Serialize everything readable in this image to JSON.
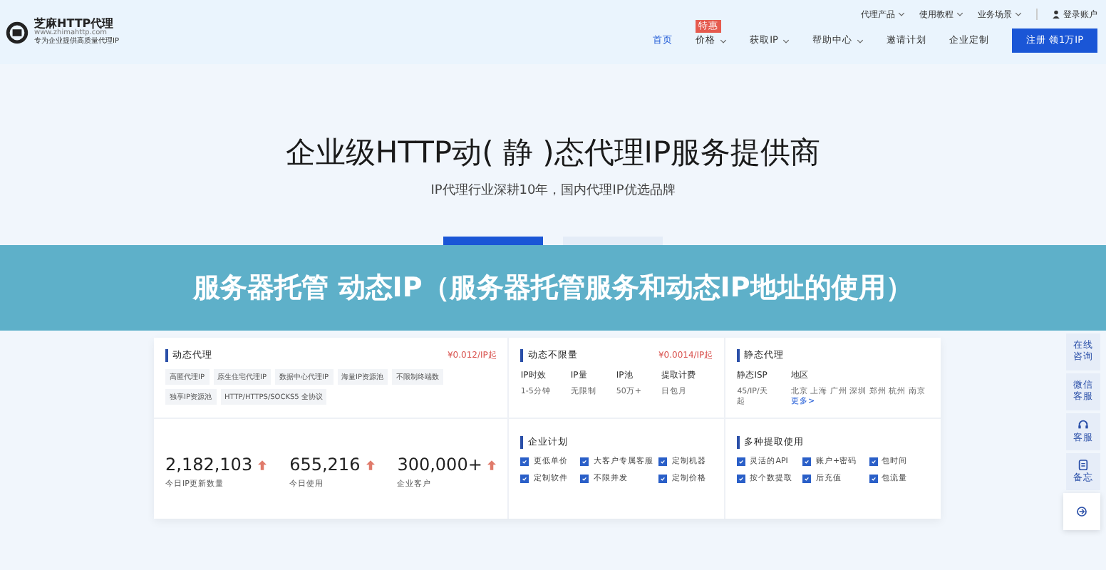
{
  "header": {
    "logo": {
      "name": "芝麻HTTP代理",
      "domain": "www.zhimahttp.com",
      "slogan": "专为企业提供高质量代理IP"
    },
    "top_links": [
      "代理产品",
      "使用教程",
      "业务场景"
    ],
    "account": "登录账户",
    "nav": [
      {
        "label": "首页",
        "selected": true,
        "dropdown": false
      },
      {
        "label": "价格",
        "selected": false,
        "dropdown": true,
        "badge": "特惠"
      },
      {
        "label": "获取IP",
        "selected": false,
        "dropdown": true
      },
      {
        "label": "帮助中心",
        "selected": false,
        "dropdown": true
      },
      {
        "label": "邀请计划",
        "selected": false,
        "dropdown": false
      },
      {
        "label": "企业定制",
        "selected": false,
        "dropdown": false
      }
    ],
    "register_button": "注册 领1万IP"
  },
  "hero": {
    "title": "企业级HTTP动( 静 )态代理IP服务提供商",
    "subtitle": "IP代理行业深耕10年，国内代理IP优选品牌"
  },
  "banner": "服务器托管 动态IP（服务器托管服务和动态IP地址的使用）",
  "dynamic": {
    "title": "动态代理",
    "price": "¥0.012/IP起",
    "tags": [
      "高匿代理IP",
      "原生住宅代理IP",
      "数据中心代理IP",
      "海量IP资源池",
      "不限制终端数",
      "独享IP资源池",
      "HTTP/HTTPS/SOCKS5 全协议"
    ],
    "stats": [
      {
        "value": "2,182,103",
        "label": "今日IP更新数量"
      },
      {
        "value": "655,216",
        "label": "今日使用"
      },
      {
        "value": "300,000+",
        "label": "企业客户"
      }
    ]
  },
  "unlimited": {
    "title": "动态不限量",
    "price": "¥0.0014/IP起",
    "specs": [
      {
        "name": "IP时效",
        "value": "1-5分钟"
      },
      {
        "name": "IP量",
        "value": "无限制"
      },
      {
        "name": "IP池",
        "value": "50万+"
      },
      {
        "name": "提取计费",
        "value": "日包月"
      }
    ]
  },
  "static": {
    "title": "静态代理",
    "isp": {
      "name": "静态ISP",
      "value": "45/IP/天起"
    },
    "region": {
      "name": "地区",
      "value": "北京 上海 广州 深圳 郑州 杭州 南京",
      "more": "更多>"
    }
  },
  "enterprise": {
    "title": "企业计划",
    "items": [
      {
        "label": "更低单价",
        "checked": true
      },
      {
        "label": "大客户专属客服",
        "checked": true
      },
      {
        "label": "定制机器",
        "checked": true
      },
      {
        "label": "定制软件",
        "checked": true
      },
      {
        "label": "不限并发",
        "checked": true
      },
      {
        "label": "定制价格",
        "checked": true
      }
    ]
  },
  "usage": {
    "title": "多种提取使用",
    "items": [
      {
        "label": "灵活的API",
        "checked": true
      },
      {
        "label": "账户+密码",
        "checked": true
      },
      {
        "label": "包时间",
        "checked": true
      },
      {
        "label": "按个数提取",
        "checked": true
      },
      {
        "label": "后充值",
        "checked": true
      },
      {
        "label": "包流量",
        "checked": true
      }
    ]
  },
  "side": [
    {
      "kind": "text",
      "label": "在线咨询"
    },
    {
      "kind": "text",
      "label": "微信客服"
    },
    {
      "kind": "headset",
      "label": "客服"
    },
    {
      "kind": "clipboard",
      "label": "备忘"
    }
  ]
}
